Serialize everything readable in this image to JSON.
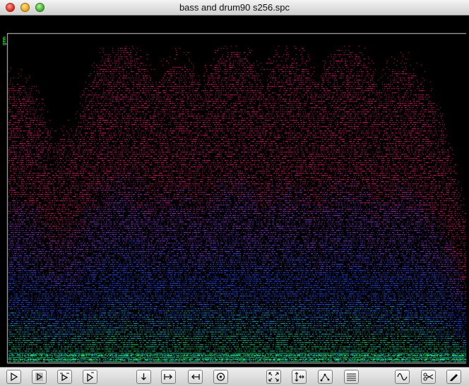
{
  "window": {
    "title": "bass and drum90 s256.spc"
  },
  "plot": {
    "axis_label": "gmm"
  },
  "colors": {
    "background": "#000000",
    "frame": "#cfcfcf",
    "low": "#22dd66",
    "mid_low": "#22bbcc",
    "mid": "#3355ff",
    "mid_high": "#8844dd",
    "high": "#ee2277"
  },
  "toolbar": {
    "buttons": [
      {
        "name": "play-button",
        "icon": "play-icon"
      },
      {
        "name": "play-selection-button",
        "icon": "play-selection-icon"
      },
      {
        "name": "play-loop-button",
        "icon": "play-loop-icon"
      },
      {
        "name": "play-step-button",
        "icon": "play-step-icon"
      },
      {
        "name": "jump-down-button",
        "icon": "arrow-down-icon"
      },
      {
        "name": "jump-right-button",
        "icon": "arrow-right-bar-icon"
      },
      {
        "name": "jump-left-button",
        "icon": "arrow-left-bar-icon"
      },
      {
        "name": "record-button",
        "icon": "record-icon"
      },
      {
        "name": "zoom-fit-button",
        "icon": "expand-icon"
      },
      {
        "name": "zoom-axes-button",
        "icon": "zoom-axes-icon"
      },
      {
        "name": "points-button",
        "icon": "scatter-icon"
      },
      {
        "name": "spectrum-lines-button",
        "icon": "lines-icon"
      },
      {
        "name": "waveform-button",
        "icon": "wave-icon"
      },
      {
        "name": "cut-button",
        "icon": "scissors-icon"
      },
      {
        "name": "edit-button",
        "icon": "pencil-icon"
      }
    ]
  }
}
